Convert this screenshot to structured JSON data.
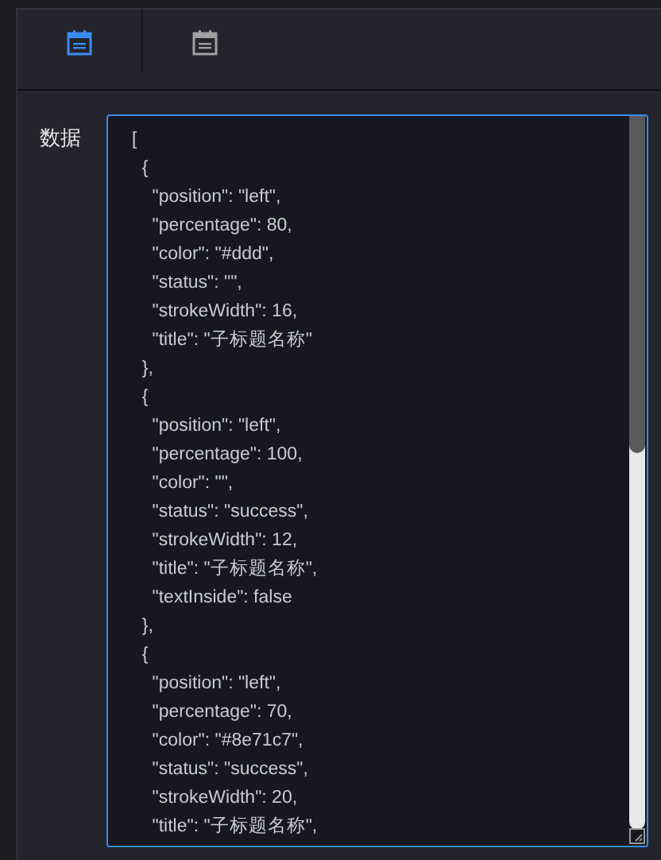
{
  "tabs": [
    {
      "selected": true
    },
    {
      "selected": false
    }
  ],
  "field": {
    "label": "数据",
    "focused": true,
    "lines": [
      "[",
      "  {",
      "    \"position\": \"left\",",
      "    \"percentage\": 80,",
      "    \"color\": \"#ddd\",",
      "    \"status\": \"\",",
      "    \"strokeWidth\": 16,",
      "    \"title\": \"子标题名称\"",
      "  },",
      "  {",
      "    \"position\": \"left\",",
      "    \"percentage\": 100,",
      "    \"color\": \"\",",
      "    \"status\": \"success\",",
      "    \"strokeWidth\": 12,",
      "    \"title\": \"子标题名称\",",
      "    \"textInside\": false",
      "  },",
      "  {",
      "    \"position\": \"left\",",
      "    \"percentage\": 70,",
      "    \"color\": \"#8e71c7\",",
      "    \"status\": \"success\",",
      "    \"strokeWidth\": 20,",
      "    \"title\": \"子标题名称\","
    ]
  }
}
